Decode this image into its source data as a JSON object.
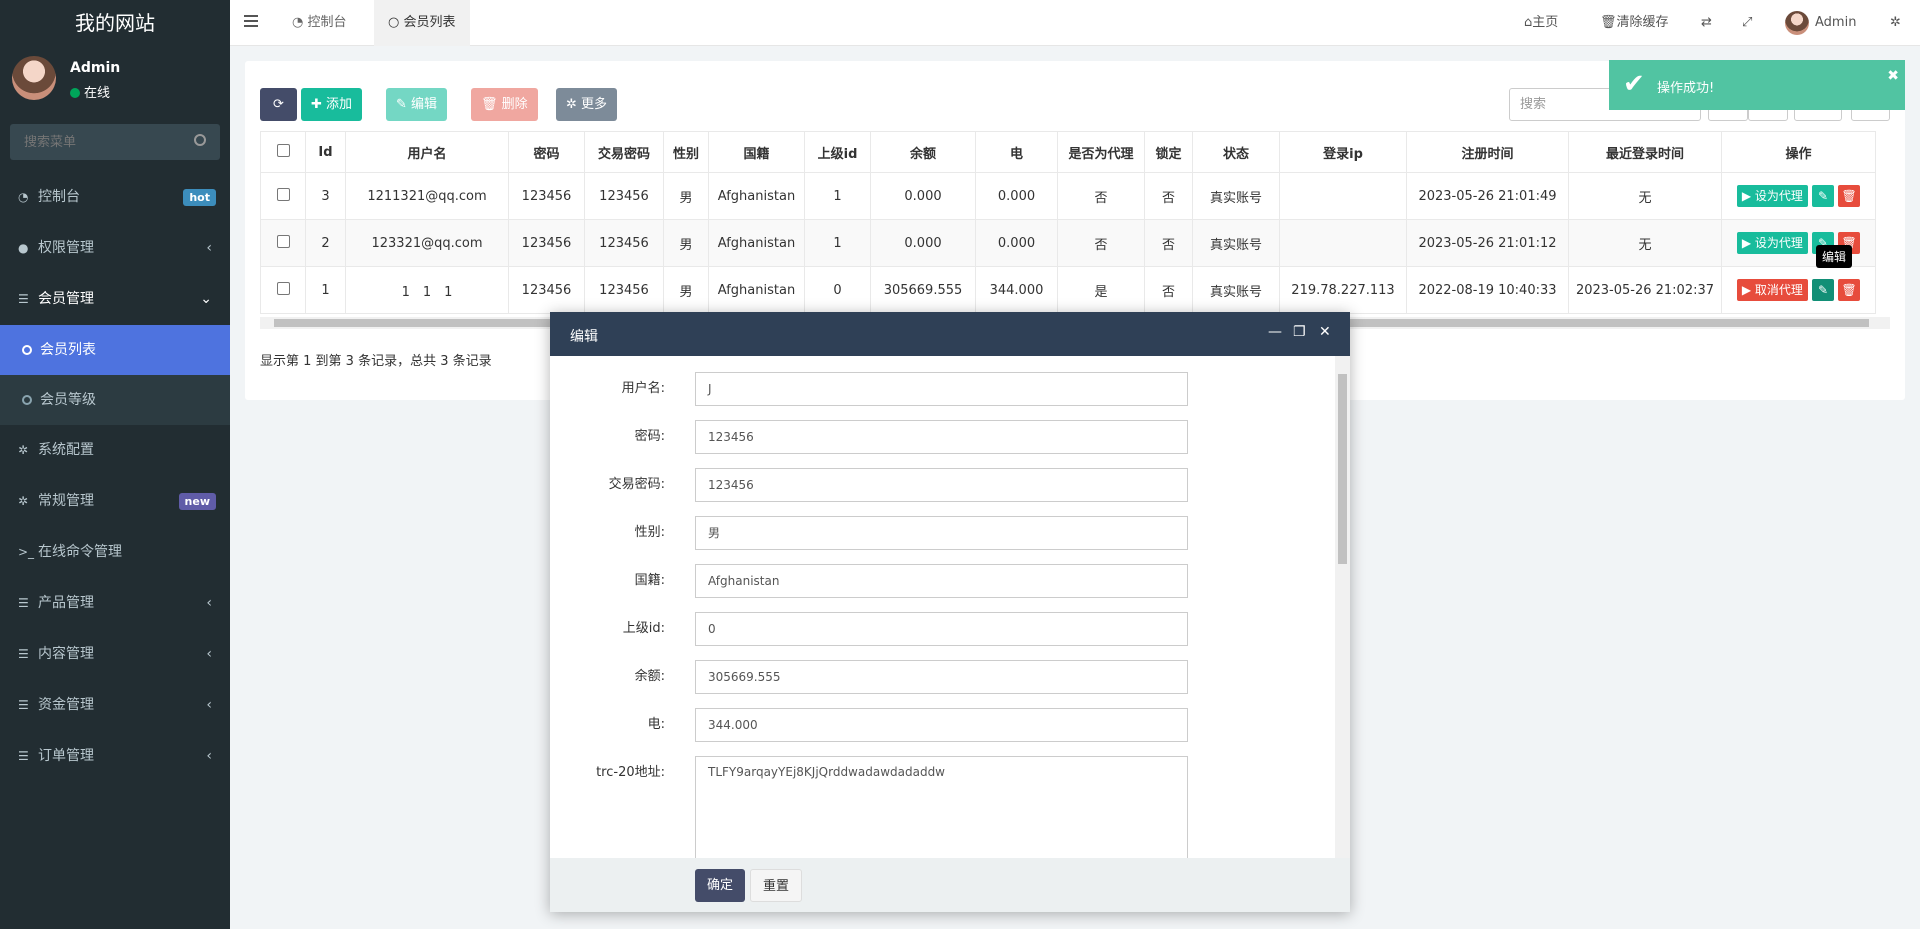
{
  "sidebar": {
    "logo": "我的网站",
    "user": {
      "name": "Admin",
      "status": "在线"
    },
    "search_placeholder": "搜索菜单",
    "items": [
      {
        "label": "控制台",
        "icon": "dashboard-icon",
        "badge": "hot"
      },
      {
        "label": "权限管理",
        "icon": "users-icon"
      },
      {
        "label": "会员管理",
        "icon": "list-icon"
      },
      {
        "label": "系统配置",
        "icon": "gear-icon"
      },
      {
        "label": "常规管理",
        "icon": "cogs-icon",
        "badge": "new"
      },
      {
        "label": "在线命令管理",
        "icon": "terminal-icon"
      },
      {
        "label": "产品管理",
        "icon": "list-icon"
      },
      {
        "label": "内容管理",
        "icon": "list-icon"
      },
      {
        "label": "资金管理",
        "icon": "list-icon"
      },
      {
        "label": "订单管理",
        "icon": "list-icon"
      }
    ],
    "submenu": [
      {
        "label": "会员列表"
      },
      {
        "label": "会员等级"
      }
    ]
  },
  "header": {
    "tabs": [
      {
        "label": "控制台",
        "icon": "dashboard-icon"
      },
      {
        "label": "会员列表",
        "icon": "circle-icon"
      }
    ],
    "right": {
      "home": "主页",
      "clear_cache": "清除缓存",
      "user": "Admin"
    }
  },
  "toolbar": {
    "add": "添加",
    "edit": "编辑",
    "delete": "删除",
    "more": "更多",
    "search_placeholder": "搜索"
  },
  "table": {
    "columns": [
      "Id",
      "用户名",
      "密码",
      "交易密码",
      "性别",
      "国籍",
      "上级id",
      "余额",
      "电",
      "是否为代理",
      "锁定",
      "状态",
      "登录ip",
      "注册时间",
      "最近登录时间",
      "操作"
    ],
    "rows": [
      {
        "id": "3",
        "username": "1211321@qq.com",
        "password": "123456",
        "trade_password": "123456",
        "gender": "男",
        "country": "Afghanistan",
        "parent_id": "1",
        "balance": "0.000",
        "power": "0.000",
        "is_agent": "否",
        "locked": "否",
        "status": "真实账号",
        "login_ip": "",
        "reg_time": "2023-05-26 21:01:49",
        "last_login": "无",
        "action": "设为代理"
      },
      {
        "id": "2",
        "username": "123321@qq.com",
        "password": "123456",
        "trade_password": "123456",
        "gender": "男",
        "country": "Afghanistan",
        "parent_id": "1",
        "balance": "0.000",
        "power": "0.000",
        "is_agent": "否",
        "locked": "否",
        "status": "真实账号",
        "login_ip": "",
        "reg_time": "2023-05-26 21:01:12",
        "last_login": "无",
        "action": "设为代理"
      },
      {
        "id": "1",
        "username": "1　1　1",
        "password": "123456",
        "trade_password": "123456",
        "gender": "男",
        "country": "Afghanistan",
        "parent_id": "0",
        "balance": "305669.555",
        "power": "344.000",
        "is_agent": "是",
        "locked": "否",
        "status": "真实账号",
        "login_ip": "219.78.227.113",
        "reg_time": "2022-08-19 10:40:33",
        "last_login": "2023-05-26 21:02:37",
        "action": "取消代理"
      }
    ]
  },
  "pagination_info": "显示第 1 到第 3 条记录，总共 3 条记录",
  "toast": {
    "message": "操作成功!"
  },
  "tooltip": "编辑",
  "modal": {
    "title": "编辑",
    "fields": [
      {
        "label": "用户名:",
        "value": "J"
      },
      {
        "label": "密码:",
        "value": "123456"
      },
      {
        "label": "交易密码:",
        "value": "123456"
      },
      {
        "label": "性别:",
        "value": "男"
      },
      {
        "label": "国籍:",
        "value": "Afghanistan"
      },
      {
        "label": "上级id:",
        "value": "0"
      },
      {
        "label": "余额:",
        "value": "305669.555"
      },
      {
        "label": "电:",
        "value": "344.000"
      },
      {
        "label": "trc-20地址:",
        "value": "TLFY9arqayYEj8KJjQrddwadawdadaddw"
      }
    ],
    "confirm": "确定",
    "reset": "重置"
  },
  "colors": {
    "sidebar_bg": "#222d32",
    "active": "#4e73df",
    "green": "#18bc9c",
    "red": "#e74c3c",
    "modal_header": "#2f4056"
  }
}
